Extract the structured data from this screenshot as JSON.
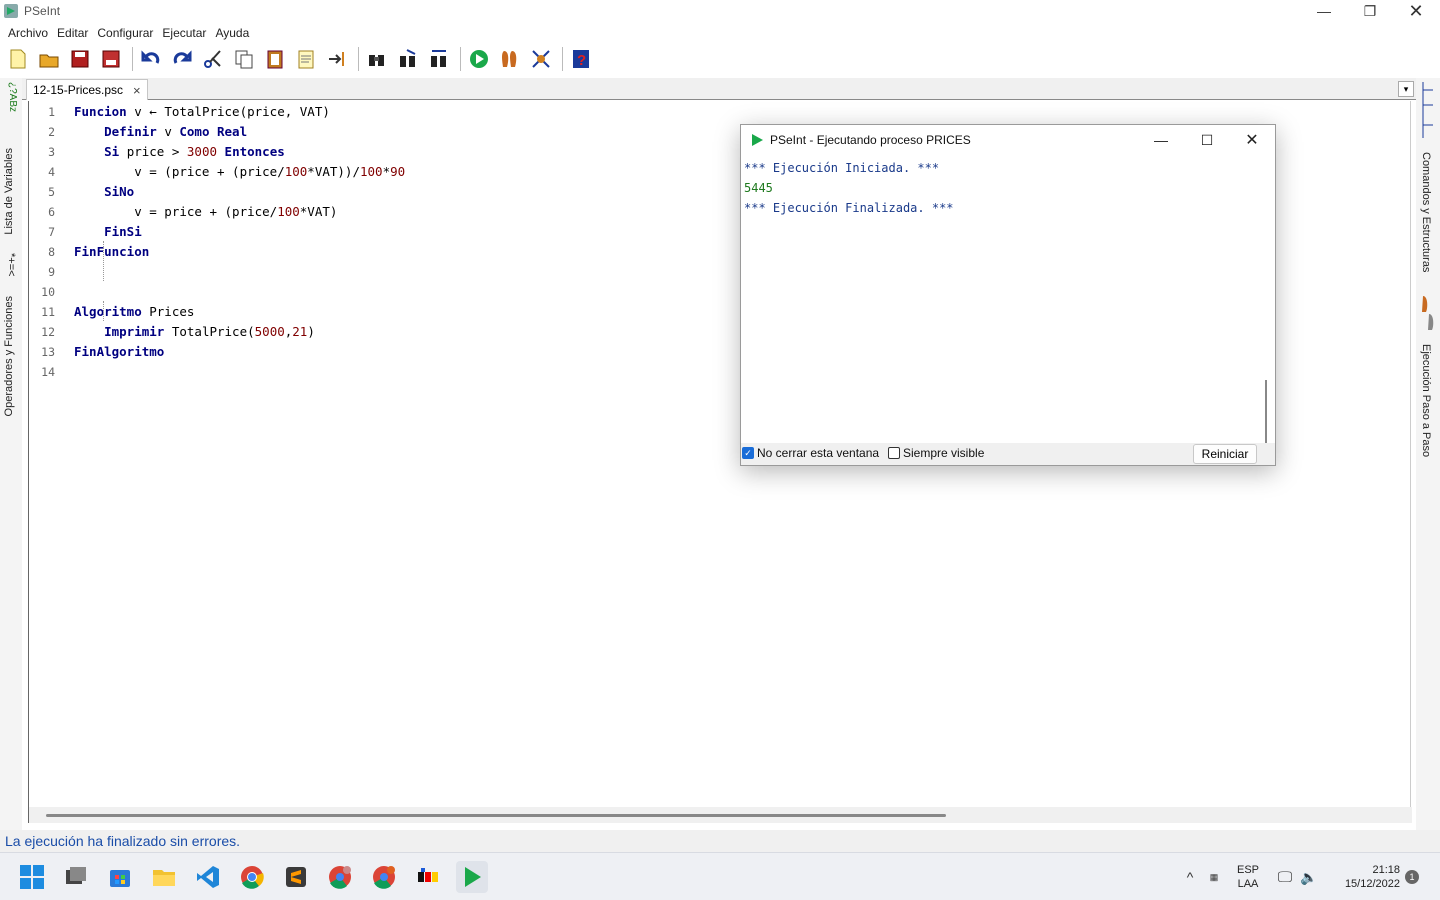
{
  "window": {
    "title": "PSeInt"
  },
  "menu": [
    "Archivo",
    "Editar",
    "Configurar",
    "Ejecutar",
    "Ayuda"
  ],
  "toolbar": {
    "icons": [
      "new-file-icon",
      "open-folder-icon",
      "save-icon",
      "save-as-icon",
      "undo-icon",
      "redo-icon",
      "cut-icon",
      "copy-icon",
      "paste-icon",
      "edit-icon",
      "indent-icon",
      "find-icon",
      "find-next-icon",
      "replace-icon",
      "run-icon",
      "step-icon",
      "debug-icon",
      "help-icon"
    ]
  },
  "left_panel": {
    "variables": "Lista de Variables",
    "operators": "Operadores y Funciones"
  },
  "right_panel": {
    "commands": "Comandos y Estructuras",
    "stepping": "Ejecución Paso a Paso"
  },
  "tab": {
    "label": "12-15-Prices.psc",
    "close": "×"
  },
  "editor": {
    "line_numbers": [
      "1",
      "2",
      "3",
      "4",
      "5",
      "6",
      "7",
      "8",
      "9",
      "10",
      "11",
      "12",
      "13",
      "14"
    ],
    "lines": [
      [
        {
          "t": "Funcion",
          "c": "kw"
        },
        {
          "t": " v ← TotalPrice(price, VAT)",
          "c": ""
        }
      ],
      [
        {
          "t": "    ",
          "c": ""
        },
        {
          "t": "Definir",
          "c": "kw"
        },
        {
          "t": " v ",
          "c": ""
        },
        {
          "t": "Como Real",
          "c": "kw"
        }
      ],
      [
        {
          "t": "    ",
          "c": ""
        },
        {
          "t": "Si",
          "c": "kw"
        },
        {
          "t": " price > ",
          "c": ""
        },
        {
          "t": "3000",
          "c": "num"
        },
        {
          "t": " ",
          "c": ""
        },
        {
          "t": "Entonces",
          "c": "kw"
        }
      ],
      [
        {
          "t": "        v = (price + (price/",
          "c": ""
        },
        {
          "t": "100",
          "c": "num"
        },
        {
          "t": "*VAT))/",
          "c": ""
        },
        {
          "t": "100",
          "c": "num"
        },
        {
          "t": "*",
          "c": ""
        },
        {
          "t": "90",
          "c": "num"
        }
      ],
      [
        {
          "t": "    ",
          "c": ""
        },
        {
          "t": "SiNo",
          "c": "kw"
        }
      ],
      [
        {
          "t": "        v = price + (price/",
          "c": ""
        },
        {
          "t": "100",
          "c": "num"
        },
        {
          "t": "*VAT)",
          "c": ""
        }
      ],
      [
        {
          "t": "    ",
          "c": ""
        },
        {
          "t": "FinSi",
          "c": "kw"
        }
      ],
      [
        {
          "t": "FinFuncion",
          "c": "kw"
        }
      ],
      [],
      [],
      [
        {
          "t": "Algoritmo",
          "c": "kw"
        },
        {
          "t": " Prices",
          "c": ""
        }
      ],
      [
        {
          "t": "    ",
          "c": ""
        },
        {
          "t": "Imprimir",
          "c": "kw"
        },
        {
          "t": " TotalPrice(",
          "c": ""
        },
        {
          "t": "5000",
          "c": "num"
        },
        {
          "t": ",",
          "c": ""
        },
        {
          "t": "21",
          "c": "num"
        },
        {
          "t": ")",
          "c": ""
        }
      ],
      [
        {
          "t": "FinAlgoritmo",
          "c": "kw"
        }
      ],
      []
    ]
  },
  "status": "La ejecución ha finalizado sin errores.",
  "exec_window": {
    "title": "PSeInt - Ejecutando proceso PRICES",
    "console": [
      {
        "text": "*** Ejecución Iniciada. ***",
        "color": "#1a3a8a"
      },
      {
        "text": "5445",
        "color": "#1f7a1f"
      },
      {
        "text": "*** Ejecución Finalizada. ***",
        "color": "#1a3a8a"
      }
    ],
    "no_close_label": "No cerrar esta ventana",
    "always_visible_label": "Siempre visible",
    "restart_label": "Reiniciar",
    "no_close_checked": true,
    "always_visible_checked": false
  },
  "taskbar": {
    "apps": [
      "windows-start-icon",
      "task-view-icon",
      "store-icon",
      "file-explorer-icon",
      "vscode-icon",
      "chrome-icon",
      "sublime-icon",
      "chrome-profile-icon",
      "chrome-profile2-icon",
      "terminal-icon",
      "pseint-icon"
    ],
    "lang_top": "ESP",
    "lang_bottom": "LAA",
    "time": "21:18",
    "date": "15/12/2022",
    "notification_count": "1"
  },
  "colors": {
    "keyword": "#000080",
    "number": "#800000",
    "status": "#1a4da8",
    "accent": "#1a6dd8"
  }
}
